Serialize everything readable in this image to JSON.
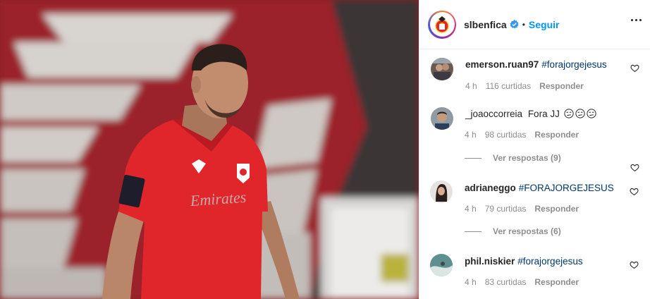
{
  "post": {
    "account": "slbenfica",
    "follow_label": "Seguir",
    "separator": "•"
  },
  "comments": [
    {
      "user": "emerson.ruan97",
      "tag": "#forajorgejesus",
      "text": "",
      "time": "4 h",
      "likes": "116 curtidas",
      "reply": "Responder",
      "view_replies": ""
    },
    {
      "user": "_joaoccorreia",
      "tag": "",
      "text": "Fora JJ",
      "time": "4 h",
      "likes": "98 curtidas",
      "reply": "Responder",
      "view_replies": "Ver respostas (9)"
    },
    {
      "user": "adrianeggo",
      "tag": "#FORAJORGEJESUS",
      "text": "",
      "time": "4 h",
      "likes": "79 curtidas",
      "reply": "Responder",
      "view_replies": "Ver respostas (6)"
    },
    {
      "user": "phil.niskier",
      "tag": "#forajorgejesus",
      "text": "",
      "time": "4 h",
      "likes": "83 curtidas",
      "reply": "Responder",
      "view_replies": ""
    }
  ],
  "icons": {
    "verified": "verified-badge-icon",
    "more": "more-options-icon",
    "like": "heart-icon",
    "emoji": "unamused-face-emoji"
  },
  "colors": {
    "link": "#0095f6",
    "hashtag": "#00376b",
    "muted": "#8e8e8e",
    "jersey": "#e0262b"
  },
  "jersey": {
    "sponsor": "Emirates"
  }
}
